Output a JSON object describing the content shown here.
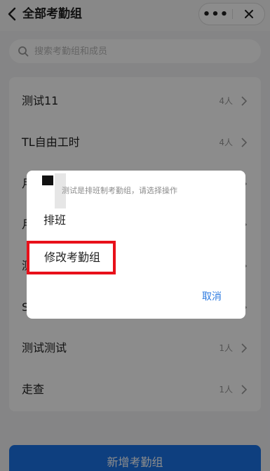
{
  "header": {
    "title": "全部考勤组",
    "more_label": "•••"
  },
  "search": {
    "placeholder": "搜索考勤组和成员"
  },
  "list": [
    {
      "name": "测试11",
      "count": "4人"
    },
    {
      "name": "TL自由工时",
      "count": "4人"
    },
    {
      "name": "月",
      "count": ""
    },
    {
      "name": "月",
      "count": ""
    },
    {
      "name": "测",
      "count": ""
    },
    {
      "name": "S",
      "count": ""
    },
    {
      "name": "测试测试",
      "count": "1人"
    },
    {
      "name": "走查",
      "count": "1人"
    }
  ],
  "footer": {
    "add_label": "新增考勤组"
  },
  "dialog": {
    "message": "测试是排班制考勤组，请选择操作",
    "option_schedule": "排班",
    "option_edit": "修改考勤组",
    "cancel_label": "取消"
  },
  "colors": {
    "primary": "#1a73e8",
    "cancel_text": "#2c7ae0",
    "highlight": "#e8101a"
  }
}
